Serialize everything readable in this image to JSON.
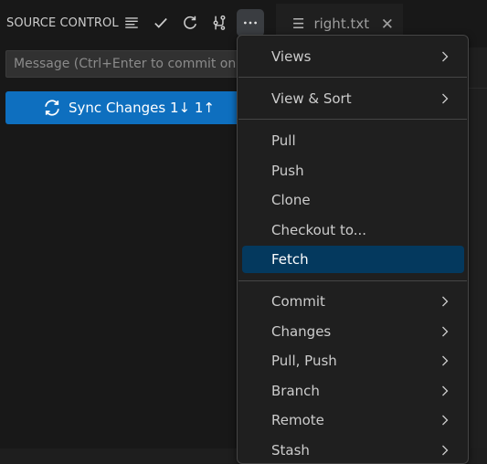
{
  "source_control": {
    "title": "SOURCE CONTROL",
    "message_placeholder": "Message (Ctrl+Enter to commit on",
    "sync_label": "Sync Changes 1↓ 1↑"
  },
  "icons": {
    "view_as_tree": "list-tree-icon",
    "commit": "check-icon",
    "refresh": "refresh-icon",
    "graph": "git-graph-icon",
    "more": "ellipsis-icon",
    "sync": "sync-icon"
  },
  "tab": {
    "label": "right.txt"
  },
  "menu": {
    "views": "Views",
    "view_sort": "View & Sort",
    "pull": "Pull",
    "push": "Push",
    "clone": "Clone",
    "checkout": "Checkout to...",
    "fetch": "Fetch",
    "commit": "Commit",
    "changes": "Changes",
    "pull_push": "Pull, Push",
    "branch": "Branch",
    "remote": "Remote",
    "stash": "Stash"
  },
  "colors": {
    "accent": "#0e6fbf",
    "menu_highlight": "#04395e"
  }
}
